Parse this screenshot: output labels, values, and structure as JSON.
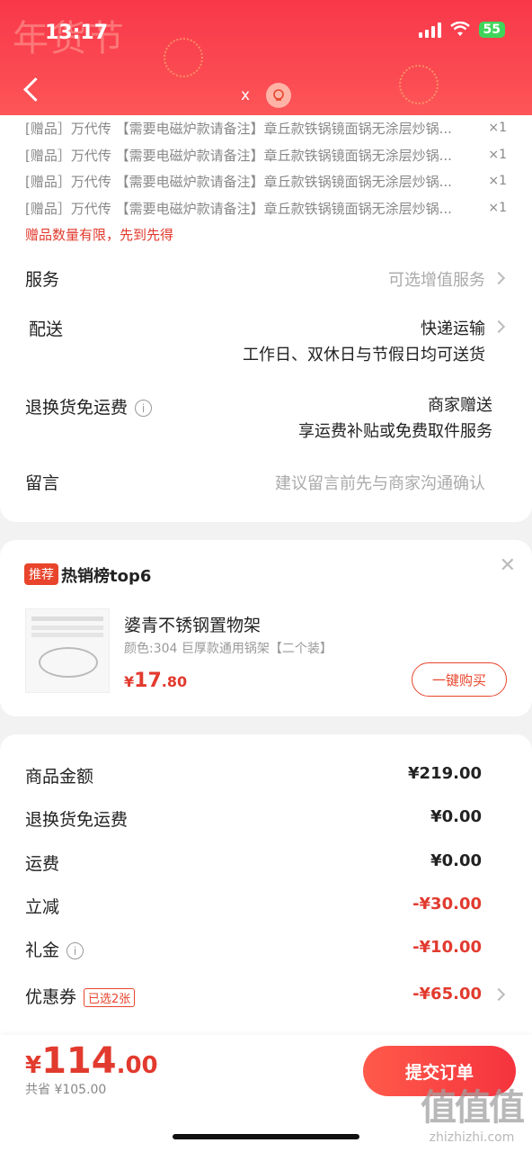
{
  "status_bar": {
    "time": "13:17",
    "battery": "55"
  },
  "header": {
    "festive_text": "年货节",
    "x_label": "x"
  },
  "gifts": {
    "items": [
      {
        "text": "[赠品］万代传 【需要电磁炉款请备注】章丘款铁锅镜面锅无涂层炒锅...",
        "qty": "×1"
      },
      {
        "text": "[赠品］万代传 【需要电磁炉款请备注】章丘款铁锅镜面锅无涂层炒锅...",
        "qty": "×1"
      },
      {
        "text": "[赠品］万代传 【需要电磁炉款请备注】章丘款铁锅镜面锅无涂层炒锅...",
        "qty": "×1"
      },
      {
        "text": "[赠品］万代传 【需要电磁炉款请备注】章丘款铁锅镜面锅无涂层炒锅...",
        "qty": "×1"
      }
    ],
    "notice": "赠品数量有限，先到先得"
  },
  "service": {
    "label": "服务",
    "value": "可选增值服务"
  },
  "delivery": {
    "label": "配送",
    "value": "快递运输",
    "note": "工作日、双休日与节假日均可送货"
  },
  "return_shipping": {
    "label": "退换货免运费",
    "value": "商家赠送",
    "note": "享运费补贴或免费取件服务"
  },
  "message": {
    "label": "留言",
    "placeholder": "建议留言前先与商家沟通确认"
  },
  "recommend": {
    "badge": "推荐",
    "title": "热销榜top6",
    "product_name": "婆青不锈钢置物架",
    "product_spec": "颜色:304 巨厚款通用锅架【二个装】",
    "price_symbol": "¥",
    "price_int": "17",
    "price_dec": ".80",
    "buy_label": "一键购买"
  },
  "summary": {
    "rows": [
      {
        "label": "商品金额",
        "value": "¥219.00"
      },
      {
        "label": "退换货免运费",
        "value": "¥0.00"
      },
      {
        "label": "运费",
        "value": "¥0.00"
      },
      {
        "label": "立减",
        "value": "-¥30.00"
      },
      {
        "label": "礼金",
        "value": "-¥10.00"
      },
      {
        "label": "优惠券",
        "value": "-¥65.00",
        "tag": "已选2张"
      }
    ]
  },
  "bottom": {
    "currency": "¥",
    "total_int": "114",
    "total_dec": ".00",
    "saved": "共省 ¥105.00",
    "submit_label": "提交订单"
  },
  "watermark": {
    "logo": "值值值",
    "text": "zhizhizhi.com"
  },
  "colors": {
    "brand_red": "#e8452c",
    "header_red": "#f8384a",
    "price_red": "#e23a2e"
  }
}
